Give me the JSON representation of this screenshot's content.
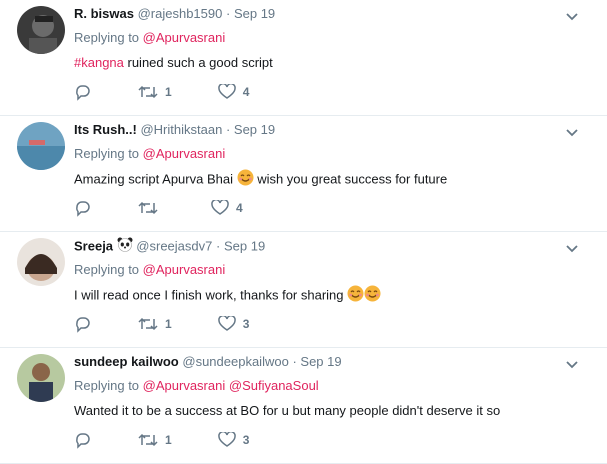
{
  "tweets": [
    {
      "name": "R. biswas",
      "handle": "@rajeshb1590",
      "date": "Sep 19",
      "replying_prefix": "Replying to",
      "reply_to": "@Apurvasrani",
      "reply_to2": "",
      "text_hashtag": "#kangna",
      "text_main": " ruined such a good script",
      "retweets": "1",
      "likes": "4"
    },
    {
      "name": "Its Rush..!",
      "handle": "@Hrithikstaan",
      "date": "Sep 19",
      "replying_prefix": "Replying to",
      "reply_to": "@Apurvasrani",
      "reply_to2": "",
      "text_before_emoji": "Amazing script Apurva Bhai ",
      "text_after_emoji": " wish you great success for future",
      "retweets": "",
      "likes": "4"
    },
    {
      "name": "Sreeja",
      "handle": "@sreejasdv7",
      "date": "Sep 19",
      "replying_prefix": "Replying to",
      "reply_to": "@Apurvasrani",
      "reply_to2": "",
      "text_main": "I will read once I finish work, thanks for sharing ",
      "retweets": "1",
      "likes": "3"
    },
    {
      "name": "sundeep kailwoo",
      "handle": "@sundeepkailwoo",
      "date": "Sep 19",
      "replying_prefix": "Replying to",
      "reply_to": "@Apurvasrani",
      "reply_to2": "@SufiyanaSoul",
      "text_main": "Wanted it to be a success at BO for u but  many people didn't deserve it so",
      "retweets": "1",
      "likes": "3"
    }
  ],
  "separator": "·",
  "icons": {
    "reply": "reply-icon",
    "retweet": "retweet-icon",
    "like": "heart-icon",
    "more": "chevron-down-icon",
    "emoji": "smiling-face-icon",
    "name_emoji": "panda-face-icon"
  },
  "colors": {
    "link": "#e0245e",
    "muted": "#657786",
    "divider": "#e6ecf0"
  }
}
